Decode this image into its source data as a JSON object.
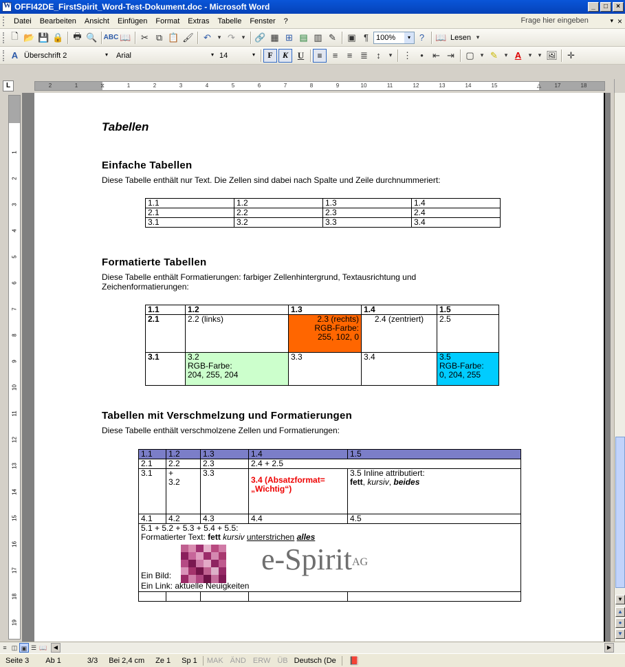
{
  "window": {
    "title": "OFFI42DE_FirstSpirit_Word-Test-Dokument.doc - Microsoft Word",
    "minimize_label": "_",
    "maximize_label": "□",
    "close_label": "×"
  },
  "menubar": {
    "items": [
      "Datei",
      "Bearbeiten",
      "Ansicht",
      "Einfügen",
      "Format",
      "Extras",
      "Tabelle",
      "Fenster",
      "?"
    ],
    "help_placeholder": "Frage hier eingeben"
  },
  "standard_toolbar": {
    "zoom": "100%",
    "read_label": "Lesen"
  },
  "format_toolbar": {
    "style": "Überschrift 2",
    "font": "Arial",
    "size": "14",
    "bold_label": "F",
    "italic_label": "K",
    "underline_label": "U"
  },
  "ruler": {
    "tabstop_label": "L",
    "labels": [
      "2",
      "1",
      "1",
      "2",
      "3",
      "4",
      "5",
      "6",
      "7",
      "8",
      "9",
      "10",
      "11",
      "12",
      "13",
      "14",
      "15",
      "17",
      "18"
    ],
    "vlabels": [
      "1",
      "2",
      "3",
      "4",
      "5",
      "6",
      "7",
      "8",
      "9",
      "10",
      "11",
      "12",
      "13",
      "14",
      "15",
      "16",
      "17",
      "18",
      "19"
    ]
  },
  "document": {
    "heading_tabellen": "Tabellen",
    "simple": {
      "heading": "Einfache Tabellen",
      "description": "Diese Tabelle enthält nur Text. Die Zellen sind dabei nach Spalte und Zeile durchnummeriert:",
      "rows": [
        [
          "1.1",
          "1.2",
          "1.3",
          "1.4"
        ],
        [
          "2.1",
          "2.2",
          "2.3",
          "2.4"
        ],
        [
          "3.1",
          "3.2",
          "3.3",
          "3.4"
        ]
      ]
    },
    "formatted": {
      "heading": "Formatierte Tabellen",
      "description_line1": "Diese Tabelle enthält Formatierungen: farbiger Zellenhintergrund, Textausrichtung und",
      "description_line2": "Zeichenformatierungen:",
      "header": [
        "1.1",
        "1.2",
        "1.3",
        "1.4",
        "1.5"
      ],
      "row2": {
        "c1": "2.1",
        "c2": "2.2 (links)",
        "c3_l1": "2.3 (rechts)",
        "c3_l2": "RGB-Farbe:",
        "c3_l3": "255, 102, 0",
        "c4": "2.4 (zentriert)",
        "c5": "2.5"
      },
      "row3": {
        "c1": "3.1",
        "c2_l1": "3.2",
        "c2_l2": "RGB-Farbe:",
        "c2_l3": "204, 255, 204",
        "c3": "3.3",
        "c4": "3.4",
        "c5_l1": "3.5",
        "c5_l2": "RGB-Farbe:",
        "c5_l3": "0, 204, 255"
      },
      "colors": {
        "orange": "#ff6600",
        "green": "#ccffcc",
        "cyan": "#00ccff"
      }
    },
    "merged": {
      "heading": "Tabellen mit Verschmelzung und Formatierungen",
      "description": "Diese Tabelle enthält verschmolzene Zellen und Formatierungen:",
      "header": [
        "1.1",
        "1.2",
        "1.3",
        "1.4",
        "1.5"
      ],
      "row2": [
        "2.1",
        "2.2",
        "2.3",
        "2.4 + 2.5"
      ],
      "row3": {
        "c1": "3.1",
        "c2_l1": "+",
        "c2_l2": "3.2",
        "c3": "3.3",
        "c4_l1": "3.4 (Absatzformat=",
        "c4_l2": "„Wichtig“)",
        "c5_l1": "3.5 Inline attributiert:",
        "c5_bold": "fett",
        "c5_comma1": ",",
        "c5_italic": "kursiv",
        "c5_comma2": ",",
        "c5_bolditalic": "beides"
      },
      "row4": [
        "4.1",
        "4.2",
        "4.3",
        "4.4",
        "4.5"
      ],
      "row5": {
        "line1": "5.1 + 5.2 + 5.3 + 5.4 + 5.5:",
        "line2_prefix": "Formatierter Text:",
        "line2_bold": "fett",
        "line2_italic": "kursiv",
        "line2_underline": "unterstrichen",
        "line2_all": "alles",
        "image_label": "Ein Bild:",
        "logo_text": "e-Spirit",
        "logo_sup": "AG",
        "link_line": "Ein Link: aktuelle Neuigkeiten"
      },
      "header_color": "#7b7ec8"
    }
  },
  "statusbar": {
    "page": "Seite 3",
    "section": "Ab 1",
    "pages": "3/3",
    "pos": "Bei 2,4 cm",
    "line": "Ze 1",
    "col": "Sp 1",
    "mak": "MAK",
    "and": "ÄND",
    "erw": "ERW",
    "ub": "ÜB",
    "lang": "Deutsch (De"
  }
}
